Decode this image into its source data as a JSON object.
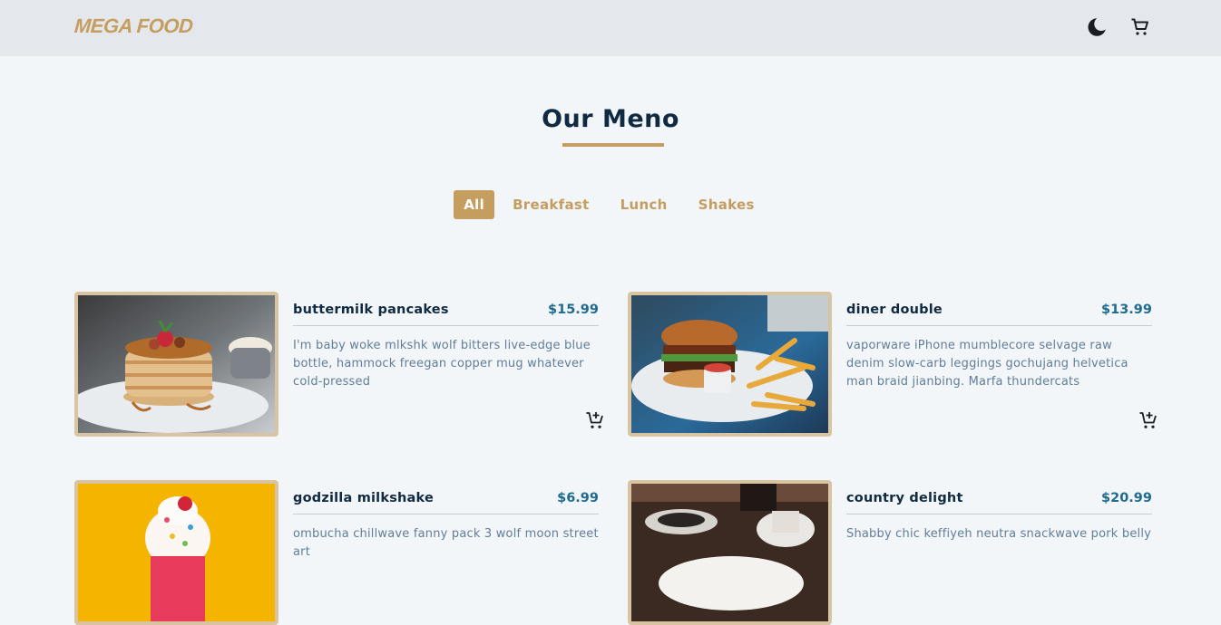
{
  "navbar": {
    "logo": "MEGA FOOD",
    "theme_icon": "moon-icon",
    "cart_icon": "cart-icon"
  },
  "section": {
    "title": "Our Meno"
  },
  "filters": [
    {
      "label": "All",
      "active": true
    },
    {
      "label": "Breakfast",
      "active": false
    },
    {
      "label": "Lunch",
      "active": false
    },
    {
      "label": "Shakes",
      "active": false
    }
  ],
  "menu": [
    {
      "name": "buttermilk pancakes",
      "price": "$15.99",
      "description": "I'm baby woke mlkshk wolf bitters live-edge blue bottle, hammock freegan copper mug whatever cold-pressed",
      "icon": "add-to-cart-icon"
    },
    {
      "name": "diner double",
      "price": "$13.99",
      "description": "vaporware iPhone mumblecore selvage raw denim slow-carb leggings gochujang helvetica man braid jianbing. Marfa thundercats",
      "icon": "add-to-cart-icon"
    },
    {
      "name": "godzilla milkshake",
      "price": "$6.99",
      "description": "ombucha chillwave fanny pack 3 wolf moon street art",
      "icon": "add-to-cart-icon"
    },
    {
      "name": "country delight",
      "price": "$20.99",
      "description": "Shabby chic keffiyeh neutra snackwave pork belly",
      "icon": "add-to-cart-icon"
    }
  ],
  "colors": {
    "accent": "#c59d5f",
    "price": "#1f6b8e",
    "background": "#f3f6f9",
    "navbar": "#e4e8ec"
  }
}
